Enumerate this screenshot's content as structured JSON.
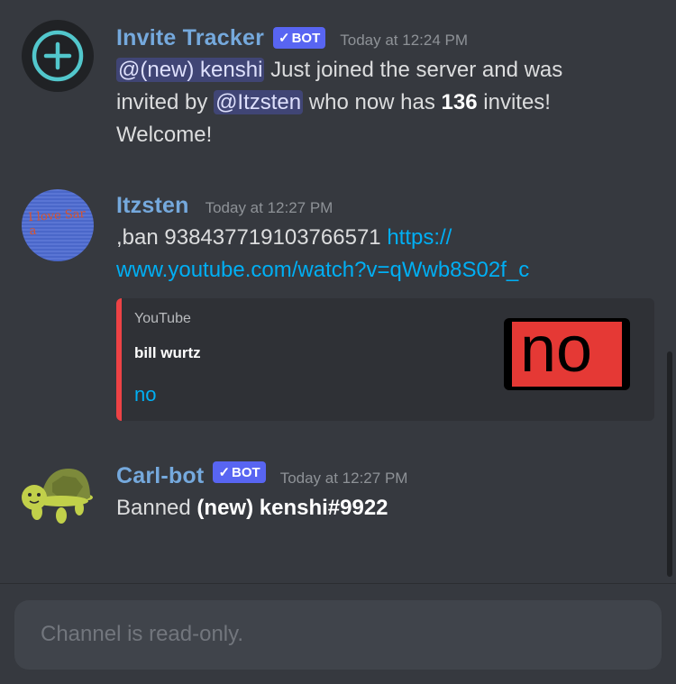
{
  "messages": [
    {
      "author": "Invite Tracker",
      "badge": "BOT",
      "timestamp": "Today at 12:24 PM",
      "mention_new": "@(new)  kenshi",
      "text_a": " Just joined the server and was",
      "text_b": "invited by ",
      "mention_inviter": "@Itzsten",
      "text_c": " who now has ",
      "count": "136",
      "text_d": " invites!",
      "text_e": "Welcome!"
    },
    {
      "author": "Itzsten",
      "timestamp": "Today at 12:27 PM",
      "text": ",ban 938437719103766571 ",
      "link_a": "https://",
      "link_b": "www.youtube.com/watch?v=qWwb8S02f_c",
      "avatar_text": "I love Sara"
    },
    {
      "author": "Carl-bot",
      "badge": "BOT",
      "timestamp": "Today at 12:27 PM",
      "text": "Banned ",
      "bold": "(new)  kenshi#9922"
    }
  ],
  "embed": {
    "provider": "YouTube",
    "author": "bill wurtz",
    "title": "no",
    "thumbnail_text": "no",
    "accent": "#ed4245"
  },
  "composer": {
    "placeholder": "Channel is read-only."
  },
  "colors": {
    "background": "#36393f",
    "link": "#00aff4",
    "author": "#75a9dd",
    "bot_badge": "#5865f2"
  }
}
